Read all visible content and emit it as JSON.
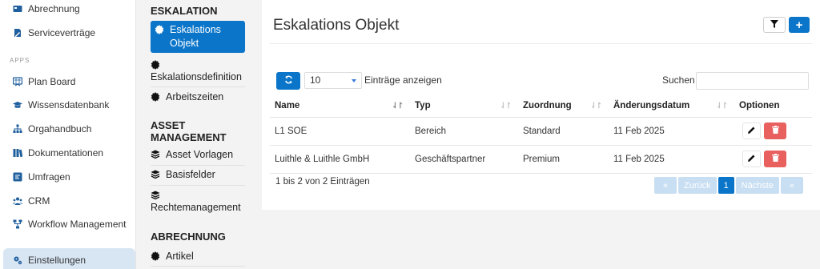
{
  "sidebar": {
    "items_top": [
      {
        "label": "Abrechnung",
        "icon": "billing-icon"
      },
      {
        "label": "Serviceverträge",
        "icon": "contract-icon"
      }
    ],
    "section_label": "APPS",
    "items_apps": [
      {
        "label": "Plan Board",
        "icon": "planboard-icon"
      },
      {
        "label": "Wissensdatenbank",
        "icon": "graduation-cap-icon"
      },
      {
        "label": "Orgahandbuch",
        "icon": "sitemap-icon"
      },
      {
        "label": "Dokumentationen",
        "icon": "documentation-icon"
      },
      {
        "label": "Umfragen",
        "icon": "poll-icon"
      },
      {
        "label": "CRM",
        "icon": "users-icon"
      },
      {
        "label": "Workflow Management",
        "icon": "workflow-icon"
      }
    ],
    "active_item": {
      "label": "Einstellungen",
      "icon": "settings-icon"
    }
  },
  "settings_menu": {
    "section1": "ESKALATION",
    "item_active": "Eskalations Objekt",
    "item2": "Eskalationsdefinition",
    "item3": "Arbeitszeiten",
    "section2": "ASSET MANAGEMENT",
    "item4": "Asset Vorlagen",
    "item5": "Basisfelder",
    "item6": "Rechtemanagement",
    "section3": "ABRECHNUNG",
    "item7": "Artikel"
  },
  "main": {
    "title": "Eskalations Objekt",
    "page_size": "10",
    "entries_label": "Einträge anzeigen",
    "search_label": "Suchen",
    "search_value": "",
    "columns": [
      "Name",
      "Typ",
      "Zuordnung",
      "Änderungsdatum",
      "Optionen"
    ],
    "rows": [
      {
        "name": "L1 SOE",
        "typ": "Bereich",
        "zuordnung": "Standard",
        "datum": "11 Feb 2025"
      },
      {
        "name": "Luithle & Luithle GmbH",
        "typ": "Geschäftspartner",
        "zuordnung": "Premium",
        "datum": "11 Feb 2025"
      }
    ],
    "info": "1 bis 2 von 2 Einträgen",
    "pager": {
      "first": "«",
      "prev": "Zurück",
      "current": "1",
      "next": "Nächste",
      "last": "»"
    }
  },
  "colors": {
    "accent": "#0a75c9",
    "danger": "#e8615f",
    "sidebar_active": "#d8e6f4"
  }
}
